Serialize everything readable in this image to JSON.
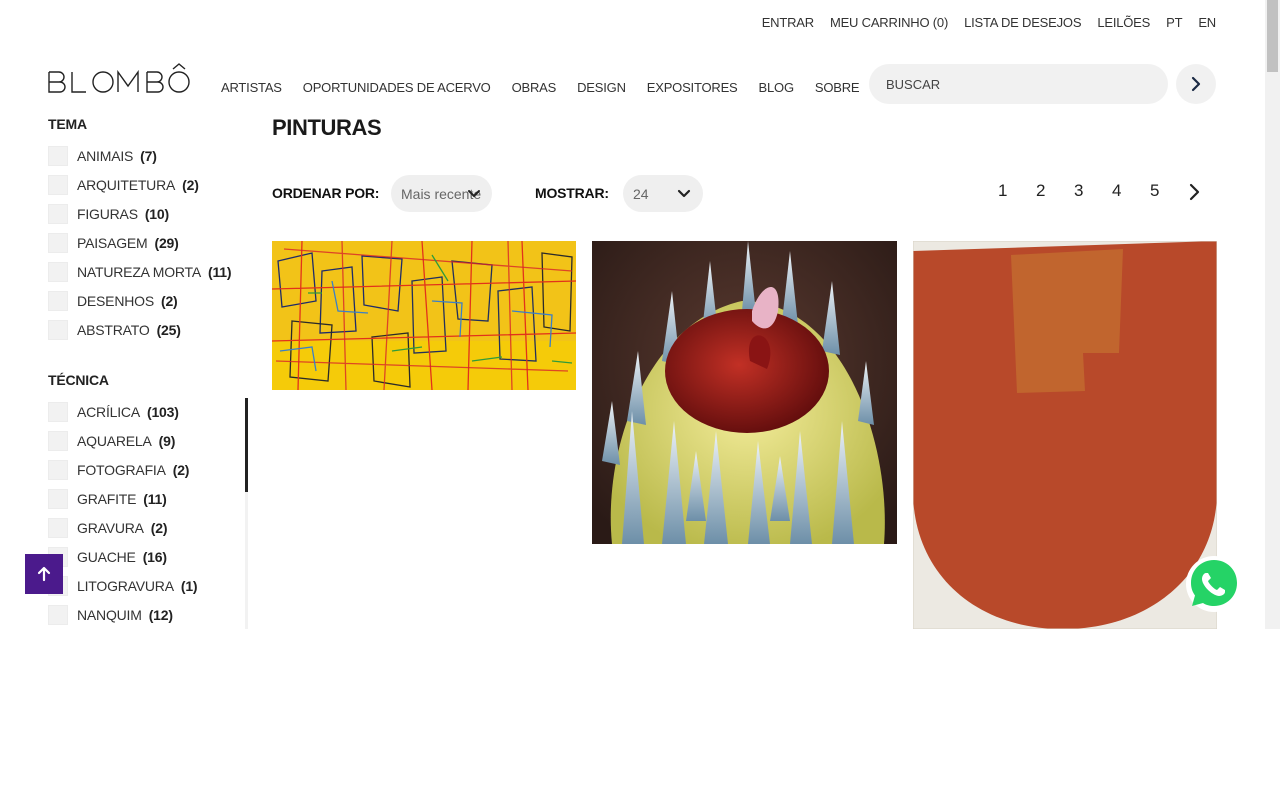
{
  "utility_nav": [
    {
      "label": "ENTRAR"
    },
    {
      "label": "MEU CARRINHO (0)"
    },
    {
      "label": "LISTA DE DESEJOS"
    },
    {
      "label": "LEILÕES"
    },
    {
      "label": "PT"
    },
    {
      "label": "EN"
    }
  ],
  "logo": {
    "text": "BLOMBÔ"
  },
  "main_nav": [
    {
      "label": "ARTISTAS"
    },
    {
      "label": "OPORTUNIDADES DE ACERVO"
    },
    {
      "label": "OBRAS"
    },
    {
      "label": "DESIGN"
    },
    {
      "label": "EXPOSITORES"
    },
    {
      "label": "BLOG"
    },
    {
      "label": "SOBRE"
    }
  ],
  "search": {
    "placeholder": "BUSCAR",
    "icon": "chevron-right-icon"
  },
  "filters": {
    "tema": {
      "title": "TEMA",
      "items": [
        {
          "label": "ANIMAIS",
          "count": "(7)"
        },
        {
          "label": "ARQUITETURA",
          "count": "(2)"
        },
        {
          "label": "FIGURAS",
          "count": "(10)"
        },
        {
          "label": "PAISAGEM",
          "count": "(29)"
        },
        {
          "label": "NATUREZA MORTA",
          "count": "(11)"
        },
        {
          "label": "DESENHOS",
          "count": "(2)"
        },
        {
          "label": "ABSTRATO",
          "count": "(25)"
        }
      ]
    },
    "tecnica": {
      "title": "TÉCNICA",
      "items": [
        {
          "label": "ACRÍLICA",
          "count": "(103)"
        },
        {
          "label": "AQUARELA",
          "count": "(9)"
        },
        {
          "label": "FOTOGRAFIA",
          "count": "(2)"
        },
        {
          "label": "GRAFITE",
          "count": "(11)"
        },
        {
          "label": "GRAVURA",
          "count": "(2)"
        },
        {
          "label": "GUACHE",
          "count": "(16)"
        },
        {
          "label": "LITOGRAVURA",
          "count": "(1)"
        },
        {
          "label": "NANQUIM",
          "count": "(12)"
        }
      ]
    }
  },
  "page": {
    "title": "PINTURAS"
  },
  "controls": {
    "sort_label": "ORDENAR POR:",
    "sort_value": "Mais recente",
    "show_label": "MOSTRAR:",
    "show_value": "24"
  },
  "pagination": {
    "pages": [
      "1",
      "2",
      "3",
      "4",
      "5"
    ],
    "next_icon": "chevron-right-icon"
  },
  "artworks": [
    {
      "name": "yellow-abstract-painting"
    },
    {
      "name": "surreal-red-form-painting"
    },
    {
      "name": "red-shield-painting"
    }
  ],
  "floating": {
    "to_top_icon": "arrow-up-icon",
    "chat_icon": "whatsapp-icon"
  },
  "colors": {
    "accent": "#4b1a8c",
    "whatsapp": "#25d366",
    "pill_bg": "#efefef"
  }
}
